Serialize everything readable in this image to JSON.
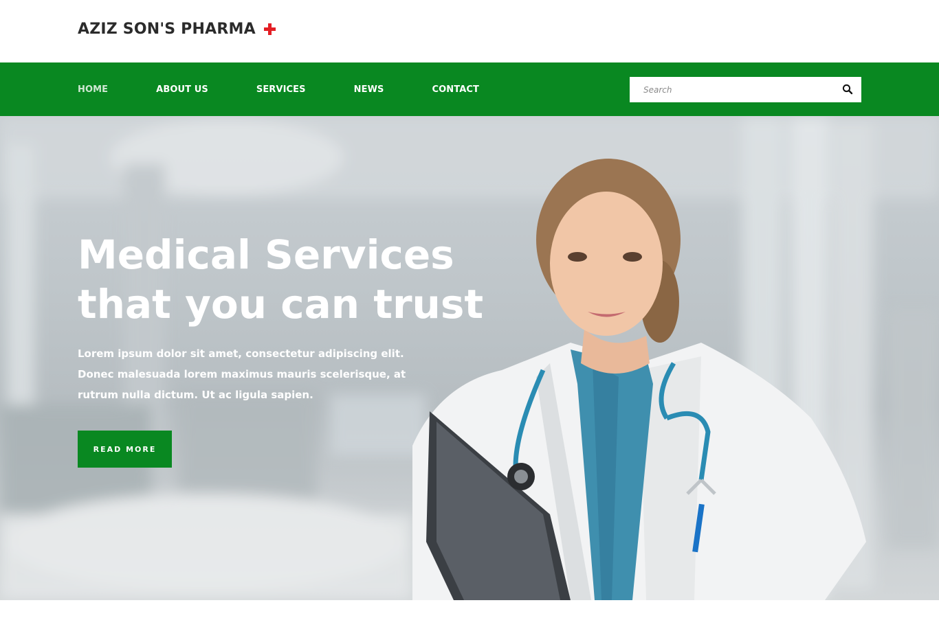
{
  "brand": {
    "name": "AZIZ SON'S PHARMA",
    "accent_color": "#e31e24"
  },
  "nav": {
    "items": [
      {
        "label": "HOME",
        "active": true
      },
      {
        "label": "ABOUT US",
        "active": false
      },
      {
        "label": "SERVICES",
        "active": false
      },
      {
        "label": "NEWS",
        "active": false
      },
      {
        "label": "CONTACT",
        "active": false
      }
    ],
    "bar_color": "#098821"
  },
  "search": {
    "placeholder": "Search",
    "value": "",
    "icon": "search-icon"
  },
  "hero": {
    "title_line1": "Medical Services",
    "title_line2": "that you can trust",
    "text": "Lorem ipsum dolor sit amet, consectetur adipiscing elit. Donec malesuada lorem maximus mauris scelerisque, at rutrum nulla dictum. Ut ac ligula sapien.",
    "button_label": "READ MORE",
    "image": "doctor-with-clipboard"
  }
}
